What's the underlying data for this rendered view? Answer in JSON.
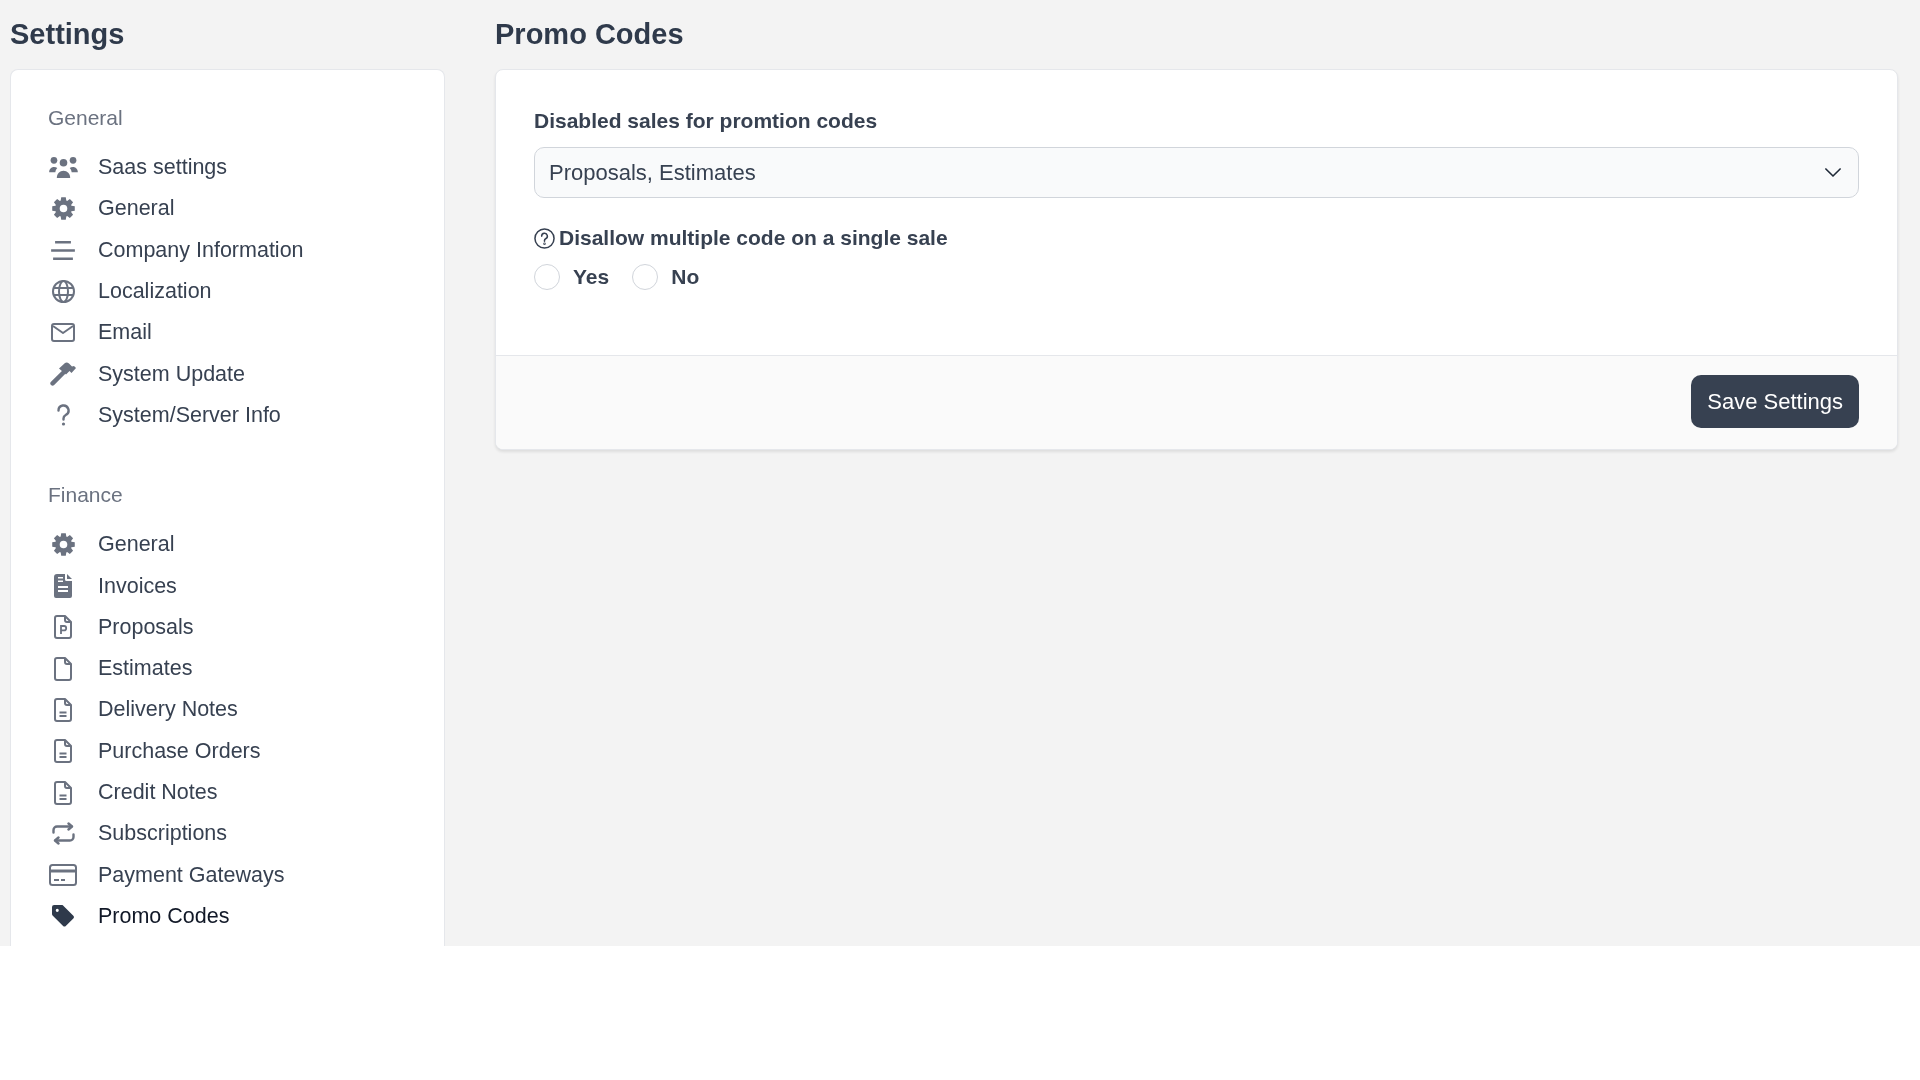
{
  "sidebar": {
    "title": "Settings",
    "sections": [
      {
        "label": "General",
        "items": [
          {
            "label": "Saas settings",
            "selected": false
          },
          {
            "label": "General",
            "selected": false
          },
          {
            "label": "Company Information",
            "selected": false
          },
          {
            "label": "Localization",
            "selected": false
          },
          {
            "label": "Email",
            "selected": false
          },
          {
            "label": "System Update",
            "selected": false
          },
          {
            "label": "System/Server Info",
            "selected": false
          }
        ]
      },
      {
        "label": "Finance",
        "items": [
          {
            "label": "General",
            "selected": false
          },
          {
            "label": "Invoices",
            "selected": false
          },
          {
            "label": "Proposals",
            "selected": false
          },
          {
            "label": "Estimates",
            "selected": false
          },
          {
            "label": "Delivery Notes",
            "selected": false
          },
          {
            "label": "Purchase Orders",
            "selected": false
          },
          {
            "label": "Credit Notes",
            "selected": false
          },
          {
            "label": "Subscriptions",
            "selected": false
          },
          {
            "label": "Payment Gateways",
            "selected": false
          },
          {
            "label": "Promo Codes",
            "selected": true
          }
        ]
      }
    ]
  },
  "main": {
    "title": "Promo Codes",
    "fields": [
      {
        "kind": "select",
        "label": "Disabled sales for promtion codes",
        "help": false,
        "value": "Proposals, Estimates"
      },
      {
        "kind": "radio",
        "label": "Disallow multiple code on a single sale",
        "help": true,
        "options": [
          {
            "label": "Yes",
            "selected": false
          },
          {
            "label": "No",
            "selected": false
          }
        ]
      }
    ],
    "buttons": [
      "Save Settings"
    ]
  }
}
